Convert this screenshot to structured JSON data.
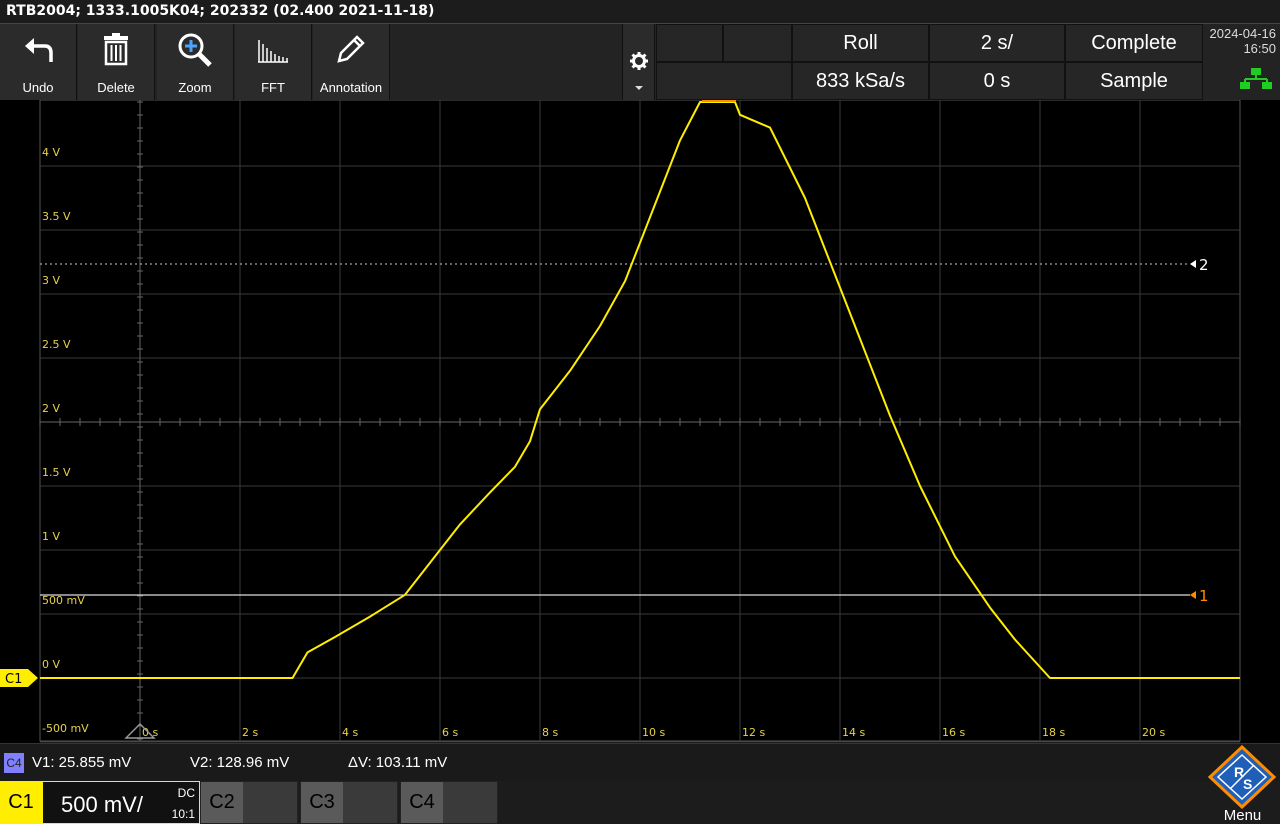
{
  "title_bar": {
    "text": "RTB2004; 1333.1005K04; 202332 (02.400 2021-11-18)"
  },
  "toolbar": {
    "buttons": [
      {
        "label": "Undo",
        "icon": "undo-icon"
      },
      {
        "label": "Delete",
        "icon": "trash-icon"
      },
      {
        "label": "Zoom",
        "icon": "zoom-icon"
      },
      {
        "label": "FFT",
        "icon": "fft-icon"
      },
      {
        "label": "Annotation",
        "icon": "pencil-icon"
      }
    ],
    "settings_icon": "gear-icon"
  },
  "acquisition": {
    "mode": "Roll",
    "time_scale": "2 s/",
    "status": "Complete",
    "sample_rate": "833 kSa/s",
    "trigger_offset": "0 s",
    "acq_type": "Sample"
  },
  "datetime": {
    "date": "2024-04-16",
    "time": "16:50"
  },
  "network_icon": "network-icon",
  "screen": {
    "y_labels": [
      "4 V",
      "3.5 V",
      "3 V",
      "2.5 V",
      "2 V",
      "1.5 V",
      "1 V",
      "500 mV",
      "0 V",
      "-500 mV"
    ],
    "x_labels": [
      "0 s",
      "2 s",
      "4 s",
      "6 s",
      "8 s",
      "10 s",
      "12 s",
      "14 s",
      "16 s",
      "18 s",
      "20 s"
    ],
    "channel_marker": "C1",
    "cursor_markers": [
      "2",
      "1"
    ],
    "trace_color": "#ffee00"
  },
  "cursor_readout": {
    "source": "C4",
    "v1": "V1: 25.855 mV",
    "v2": "V2: 128.96 mV",
    "dv": "ΔV: 103.11 mV"
  },
  "channels": {
    "c1": {
      "label": "C1",
      "scale": "500 mV/",
      "coupling": "DC",
      "probe": "10:1"
    },
    "slots": [
      "C2",
      "C3",
      "C4"
    ]
  },
  "menu": {
    "label": "Menu",
    "logo": "rs-logo-icon"
  }
}
